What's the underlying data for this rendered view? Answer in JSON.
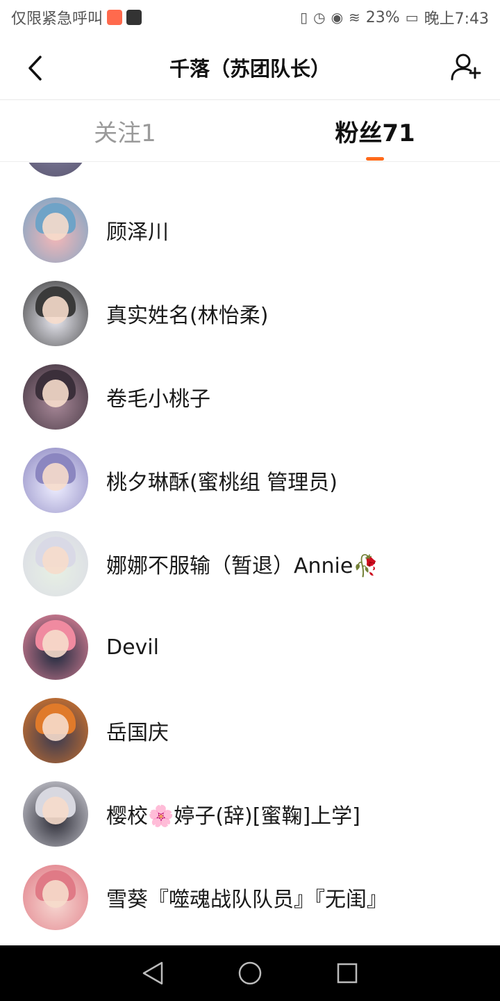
{
  "status_bar": {
    "carrier": "仅限紧急呼叫",
    "battery": "23%",
    "time": "晚上7:43"
  },
  "header": {
    "title": "千落（苏团队长）"
  },
  "tabs": [
    {
      "label": "关注1",
      "active": false
    },
    {
      "label": "粉丝71",
      "active": true
    }
  ],
  "colors": {
    "accent": "#ff6a1a"
  },
  "followers": [
    {
      "name": "顾泽川",
      "avatar_colors": [
        "#f5b7b7",
        "#6fa3c7"
      ]
    },
    {
      "name": "真实姓名(林怡柔)",
      "avatar_colors": [
        "#e8e8f0",
        "#3a3a3a"
      ]
    },
    {
      "name": "卷毛小桃子",
      "avatar_colors": [
        "#a88898",
        "#3b2f3a"
      ]
    },
    {
      "name": "桃夕琳酥(蜜桃组 管理员)",
      "avatar_colors": [
        "#eeeeff",
        "#8b86c0"
      ]
    },
    {
      "name": "娜娜不服输（暂退）Annie🥀",
      "avatar_colors": [
        "#e7f0e4",
        "#d9d9e6"
      ]
    },
    {
      "name": "Devil",
      "avatar_colors": [
        "#1e2a3e",
        "#f08aa0"
      ]
    },
    {
      "name": "岳国庆",
      "avatar_colors": [
        "#3a3a50",
        "#e07a2a"
      ]
    },
    {
      "name": "樱校🌸婷子(辞)[蜜鞠]上学]",
      "avatar_colors": [
        "#2e2e38",
        "#d8d8e0"
      ]
    },
    {
      "name": "雪葵『噬魂战队队员』『无闺』",
      "avatar_colors": [
        "#f6d6d0",
        "#e07a86"
      ]
    }
  ]
}
